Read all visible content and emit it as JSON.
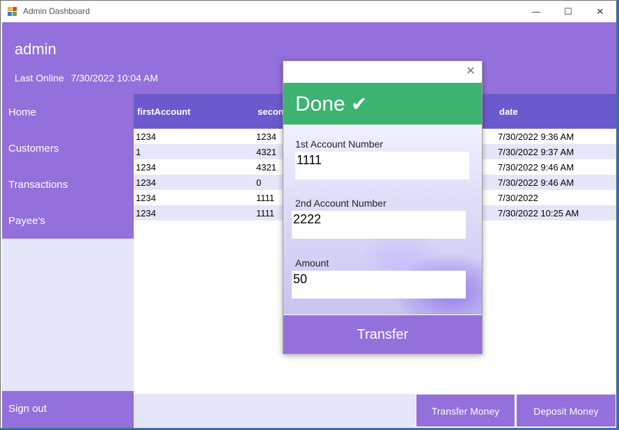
{
  "window": {
    "title": "Admin Dashboard",
    "controls": {
      "minimize": "—",
      "maximize": "☐",
      "close": "✕"
    }
  },
  "header": {
    "user": "admin",
    "last_online_label": "Last Online",
    "last_online_value": "7/30/2022 10:04 AM"
  },
  "sidebar": {
    "items": [
      {
        "label": "Home"
      },
      {
        "label": "Customers"
      },
      {
        "label": "Transactions"
      },
      {
        "label": "Payee's"
      }
    ],
    "sign_out": "Sign out"
  },
  "grid": {
    "columns": [
      "firstAccount",
      "secon",
      "date"
    ],
    "rows": [
      {
        "first": "1234",
        "second": "1234",
        "date": "7/30/2022 9:36 AM"
      },
      {
        "first": "1",
        "second": "4321",
        "date": "7/30/2022 9:37 AM"
      },
      {
        "first": "1234",
        "second": "4321",
        "date": "7/30/2022 9:46 AM"
      },
      {
        "first": "1234",
        "second": "0",
        "date": "7/30/2022 9:46 AM"
      },
      {
        "first": "1234",
        "second": "1111",
        "date": "7/30/2022"
      },
      {
        "first": "1234",
        "second": "1111",
        "date": "7/30/2022 10:25 AM"
      }
    ]
  },
  "bottom": {
    "transfer_money": "Transfer Money",
    "deposit_money": "Deposit Money"
  },
  "dialog": {
    "close": "✕",
    "status": "Done",
    "status_icon": "check-icon",
    "fields": [
      {
        "label": "1st Account Number",
        "value": "1111"
      },
      {
        "label": "2nd Account Number",
        "value": "2222"
      },
      {
        "label": "Amount",
        "value": "50"
      }
    ],
    "submit": "Transfer"
  },
  "colors": {
    "accent": "#9370db",
    "header_dark": "#6a5acd",
    "success": "#3cb371",
    "light": "#e6e6fa"
  }
}
